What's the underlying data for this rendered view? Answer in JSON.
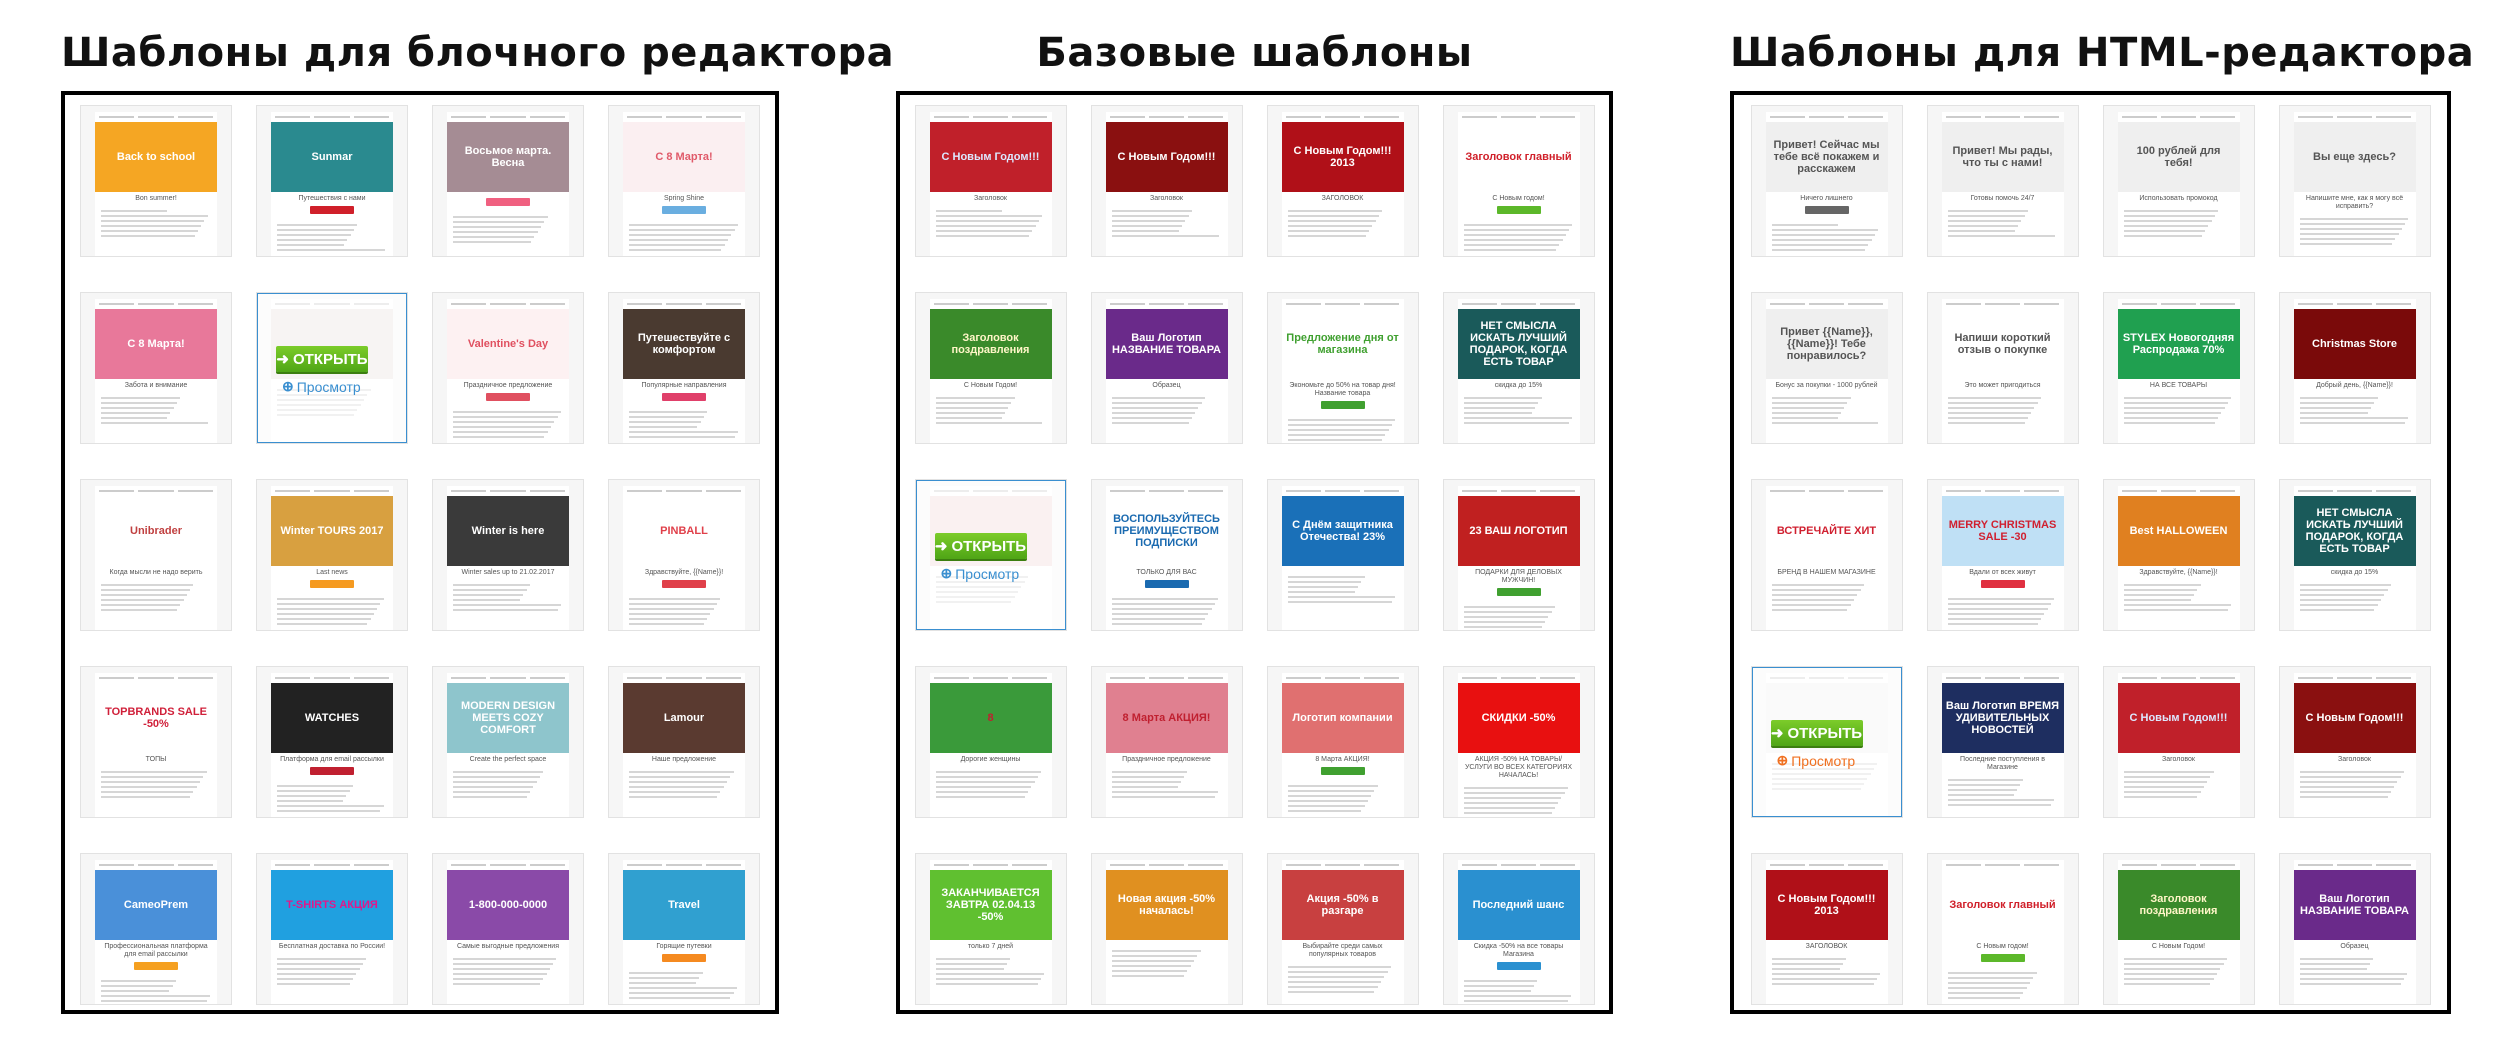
{
  "sections": [
    {
      "title": "Шаблоны для блочного редактора",
      "overlay_link_color": "#3a8fd0",
      "thumbnails": [
        {
          "headline": "Back to school",
          "sub": "Bon summer!",
          "bg": "#f5a623",
          "fg": "#ffffff"
        },
        {
          "headline": "Sunmar",
          "sub": "Путешествия с нами",
          "bg": "#2a8a8f",
          "fg": "#ffffff",
          "cta": "#d0202a"
        },
        {
          "headline": "Восьмое марта. Весна",
          "sub": "",
          "bg": "#a58c94",
          "fg": "#ffffff",
          "cta": "#f06080"
        },
        {
          "headline": "С 8 Марта!",
          "sub": "Spring Shine",
          "bg": "#fbeff1",
          "fg": "#e05a6a",
          "cta": "#6aaee0"
        },
        {
          "headline": "С 8 Марта!",
          "sub": "Забота и внимание",
          "bg": "#e8789a",
          "fg": "#ffffff"
        },
        {
          "headline": "",
          "sub": "",
          "bg": "#e8e0dc",
          "fg": "#999999",
          "overlay": true
        },
        {
          "headline": "Valentine's Day",
          "sub": "Праздничное предложение",
          "bg": "#fdf1f2",
          "fg": "#e05060",
          "cta": "#e05060"
        },
        {
          "headline": "Путешествуйте с комфортом",
          "sub": "Популярные направления",
          "bg": "#4a3a30",
          "fg": "#ffffff",
          "cta": "#e0406a"
        },
        {
          "headline": "Unibrader",
          "sub": "Когда мысли не надо верить",
          "bg": "#ffffff",
          "fg": "#c04040"
        },
        {
          "headline": "Winter TOURS 2017",
          "sub": "Last news",
          "bg": "#d8a040",
          "fg": "#ffffff",
          "cta": "#f59a20"
        },
        {
          "headline": "Winter is here",
          "sub": "Winter sales up to 21.02.2017",
          "bg": "#3a3a3a",
          "fg": "#ffffff"
        },
        {
          "headline": "PINBALL",
          "sub": "Здравствуйте, {{Name}}!",
          "bg": "#ffffff",
          "fg": "#e0404a",
          "cta": "#e0404a"
        },
        {
          "headline": "TOPBRANDS SALE -50%",
          "sub": "ТОПЫ",
          "bg": "#ffffff",
          "fg": "#d0203a"
        },
        {
          "headline": "WATCHES",
          "sub": "Платформа для email рассылки",
          "bg": "#222222",
          "fg": "#ffffff",
          "cta": "#c02030"
        },
        {
          "headline": "MODERN DESIGN MEETS COZY COMFORT",
          "sub": "Create the perfect space",
          "bg": "#8ec5cc",
          "fg": "#ffffff"
        },
        {
          "headline": "Lamour",
          "sub": "Наше предложение",
          "bg": "#5a3a30",
          "fg": "#ffffff"
        },
        {
          "headline": "CameoPrem",
          "sub": "Профессиональная платформа для email рассылки",
          "bg": "#4a90d9",
          "fg": "#ffffff",
          "cta": "#f5a020"
        },
        {
          "headline": "T-SHIRTS АКЦИЯ",
          "sub": "Бесплатная доставка по России!",
          "bg": "#20a0e0",
          "fg": "#e0188c"
        },
        {
          "headline": "1-800-000-0000",
          "sub": "Самые выгодные предложения",
          "bg": "#8a4aa8",
          "fg": "#ffffff"
        },
        {
          "headline": "Travel",
          "sub": "Горящие путевки",
          "bg": "#30a0d0",
          "fg": "#ffffff",
          "cta": "#f58a20"
        }
      ]
    },
    {
      "title": "Базовые шаблоны",
      "overlay_link_color": "#3a8fd0",
      "thumbnails": [
        {
          "headline": "С Новым Годом!!!",
          "sub": "Заголовок",
          "bg": "#c0202a",
          "fg": "#dde8ff"
        },
        {
          "headline": "С Новым Годом!!!",
          "sub": "Заголовок",
          "bg": "#8a1010",
          "fg": "#ffffff"
        },
        {
          "headline": "С Новым Годом!!! 2013",
          "sub": "ЗАГОЛОВОК",
          "bg": "#b01018",
          "fg": "#ffffff"
        },
        {
          "headline": "Заголовок главный",
          "sub": "С Новым годом!",
          "bg": "#ffffff",
          "fg": "#d0202a",
          "cta": "#5cb82a"
        },
        {
          "headline": "Заголовок поздравления",
          "sub": "С Новым Годом!",
          "bg": "#3a8a2a",
          "fg": "#fff6c8"
        },
        {
          "headline": "Ваш Логотип НАЗВАНИЕ ТОВАРА",
          "sub": "Образец",
          "bg": "#6a2a8a",
          "fg": "#ffffff"
        },
        {
          "headline": "Предложение дня от магазина",
          "sub": "Экономьте до 50% на товар дня! Название товара",
          "bg": "#ffffff",
          "fg": "#40a030",
          "cta": "#40a030"
        },
        {
          "headline": "НЕТ СМЫСЛА ИСКАТЬ ЛУЧШИЙ ПОДАРОК, КОГДА ЕСТЬ ТОВАР",
          "sub": "скидка до 15%",
          "bg": "#1a5a5a",
          "fg": "#ffffff"
        },
        {
          "headline": "",
          "sub": "",
          "bg": "#f0d8d8",
          "fg": "#999999",
          "overlay": true
        },
        {
          "headline": "ВОСПОЛЬЗУЙТЕСЬ ПРЕИМУЩЕСТВОМ ПОДПИСКИ",
          "sub": "ТОЛЬКО ДЛЯ ВАС",
          "bg": "#ffffff",
          "fg": "#1a6ab0",
          "cta": "#1a6ab0"
        },
        {
          "headline": "С Днём защитника Отечества! 23%",
          "sub": "",
          "bg": "#1a70b8",
          "fg": "#ffffff"
        },
        {
          "headline": "23 ВАШ ЛОГОТИП",
          "sub": "ПОДАРКИ ДЛЯ ДЕЛОВЫХ МУЖЧИН!",
          "bg": "#c02020",
          "fg": "#ffffff",
          "cta": "#40a030"
        },
        {
          "headline": "8",
          "sub": "Дорогие женщины",
          "bg": "#3a9a3a",
          "fg": "#c02030"
        },
        {
          "headline": "8 Марта АКЦИЯ!",
          "sub": "Праздничное предложение",
          "bg": "#e08090",
          "fg": "#c02030"
        },
        {
          "headline": "Логотип компании",
          "sub": "8 Марта АКЦИЯ!",
          "bg": "#e07070",
          "fg": "#ffffff",
          "cta": "#40a030"
        },
        {
          "headline": "СКИДКИ -50%",
          "sub": "АКЦИЯ -50% НА ТОВАРЫ/УСЛУГИ ВО ВСЕХ КАТЕГОРИЯХ НАЧАЛАСЬ!",
          "bg": "#e81010",
          "fg": "#ffffff"
        },
        {
          "headline": "ЗАКАНЧИВАЕТСЯ ЗАВТРА 02.04.13 -50%",
          "sub": "только 7 дней",
          "bg": "#60c030",
          "fg": "#ffffff"
        },
        {
          "headline": "Новая акция -50% началась!",
          "sub": "",
          "bg": "#e09020",
          "fg": "#ffffff"
        },
        {
          "headline": "Акция -50% в разгаре",
          "sub": "Выбирайте среди самых популярных товаров",
          "bg": "#c84040",
          "fg": "#ffffff"
        },
        {
          "headline": "Последний шанс",
          "sub": "Скидка -50% на все товары Магазина",
          "bg": "#2a90d0",
          "fg": "#ffffff",
          "cta": "#2a90d0"
        }
      ]
    },
    {
      "title": "Шаблоны для HTML-редактора",
      "overlay_link_color": "#f07020",
      "thumbnails": [
        {
          "headline": "Привет! Сейчас мы тебе всё покажем и расскажем",
          "sub": "Ничего лишнего",
          "bg": "#efefef",
          "fg": "#555555",
          "cta": "#666666"
        },
        {
          "headline": "Привет! Мы рады, что ты с нами!",
          "sub": "Готовы помочь 24/7",
          "bg": "#efefef",
          "fg": "#555555"
        },
        {
          "headline": "100 рублей для тебя!",
          "sub": "Использовать промокод",
          "bg": "#efefef",
          "fg": "#555555"
        },
        {
          "headline": "Вы еще здесь?",
          "sub": "Напишите мне, как я могу всё исправить?",
          "bg": "#efefef",
          "fg": "#555555"
        },
        {
          "headline": "Привет {{Name}}, {{Name}}! Тебе понравилось?",
          "sub": "Бонус за покупки - 1000 рублей",
          "bg": "#efefef",
          "fg": "#555555"
        },
        {
          "headline": "Напиши короткий отзыв о покупке",
          "sub": "Это может пригодиться",
          "bg": "#ffffff",
          "fg": "#555555"
        },
        {
          "headline": "STYLEX Новогодняя Распродажа 70%",
          "sub": "НА ВСЕ ТОВАРЫ",
          "bg": "#20a050",
          "fg": "#ffffff"
        },
        {
          "headline": "Christmas Store",
          "sub": "Добрый день, {{Name}}!",
          "bg": "#7a0a0a",
          "fg": "#ffffff"
        },
        {
          "headline": "ВСТРЕЧАЙТЕ ХИТ",
          "sub": "БРЕНД В НАШЕМ МАГАЗИНЕ",
          "bg": "#ffffff",
          "fg": "#d02030"
        },
        {
          "headline": "MERRY CHRISTMAS SALE -30",
          "sub": "Вдали от всех живут",
          "bg": "#bfe0f5",
          "fg": "#d02030",
          "cta": "#e03040"
        },
        {
          "headline": "Best HALLOWEEN",
          "sub": "Здравствуйте, {{Name}}!",
          "bg": "#e08020",
          "fg": "#ffffff"
        },
        {
          "headline": "НЕТ СМЫСЛА ИСКАТЬ ЛУЧШИЙ ПОДАРОК, КОГДА ЕСТЬ ТОВАР",
          "sub": "скидка до 15%",
          "bg": "#1a5a5a",
          "fg": "#ffffff"
        },
        {
          "headline": "",
          "sub": "",
          "bg": "#f0f0f0",
          "fg": "#999999",
          "overlay": true
        },
        {
          "headline": "Ваш Логотип ВРЕМЯ УДИВИТЕЛЬНЫХ НОВОСТЕЙ",
          "sub": "Последние поступления в Магазине",
          "bg": "#1e2e60",
          "fg": "#ffffff"
        },
        {
          "headline": "С Новым Годом!!!",
          "sub": "Заголовок",
          "bg": "#c0202a",
          "fg": "#dde8ff"
        },
        {
          "headline": "С Новым Годом!!!",
          "sub": "Заголовок",
          "bg": "#8a1010",
          "fg": "#ffffff"
        },
        {
          "headline": "С Новым Годом!!! 2013",
          "sub": "ЗАГОЛОВОК",
          "bg": "#b01018",
          "fg": "#ffffff"
        },
        {
          "headline": "Заголовок главный",
          "sub": "С Новым годом!",
          "bg": "#ffffff",
          "fg": "#d0202a",
          "cta": "#5cb82a"
        },
        {
          "headline": "Заголовок поздравления",
          "sub": "С Новым Годом!",
          "bg": "#3a8a2a",
          "fg": "#fff6c8"
        },
        {
          "headline": "Ваш Логотип НАЗВАНИЕ ТОВАРА",
          "sub": "Образец",
          "bg": "#6a2a8a",
          "fg": "#ffffff"
        }
      ]
    }
  ],
  "overlay": {
    "open_label": "ОТКРЫТЬ",
    "view_label": "Просмотр",
    "open_icon": "sign-in-icon",
    "view_icon": "zoom-in-icon",
    "open_color": "#5cb81e"
  }
}
